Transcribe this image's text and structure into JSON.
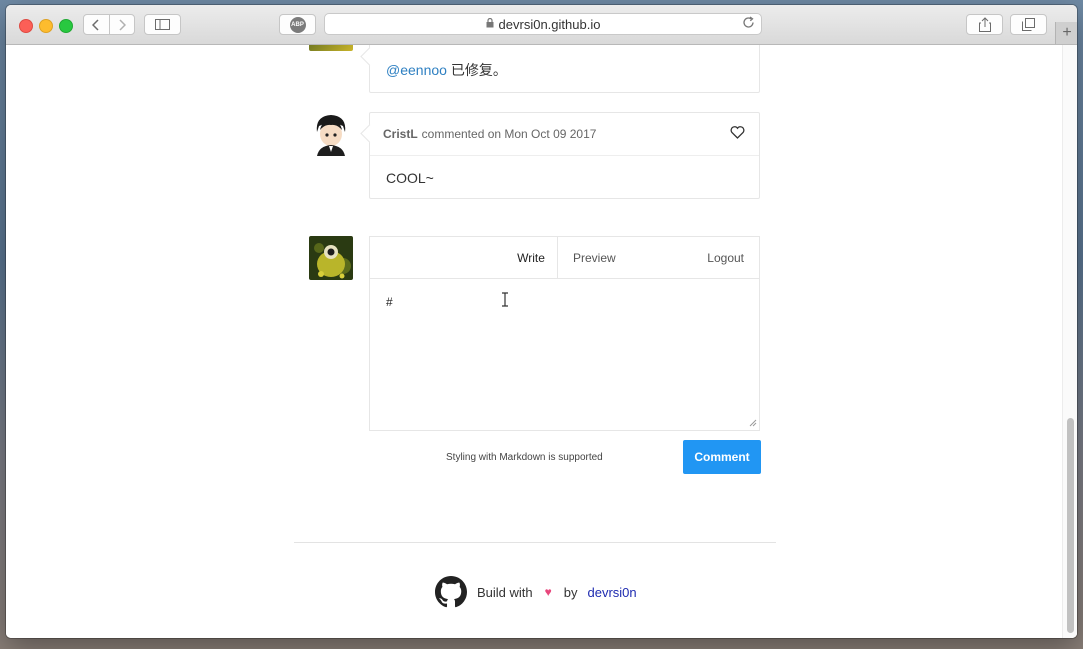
{
  "browser": {
    "url": "devrsi0n.github.io",
    "abp_label": "ABP",
    "new_tab_symbol": "+"
  },
  "comments": [
    {
      "mention": "@eennoo",
      "text": " 已修复。"
    },
    {
      "user": "CristL",
      "meta": "commented on Mon Oct 09 2017",
      "text": "COOL~"
    }
  ],
  "editor": {
    "tabs": {
      "write": "Write",
      "preview": "Preview",
      "logout": "Logout"
    },
    "value": "#",
    "markdown_note": "Styling with Markdown is supported",
    "submit_label": "Comment"
  },
  "footer": {
    "build_with": "Build with",
    "by": "by",
    "author": "devrsi0n",
    "heart": "♥"
  },
  "colors": {
    "accent": "#2196f3",
    "link": "#2f80c2",
    "heart": "#e8467c"
  }
}
